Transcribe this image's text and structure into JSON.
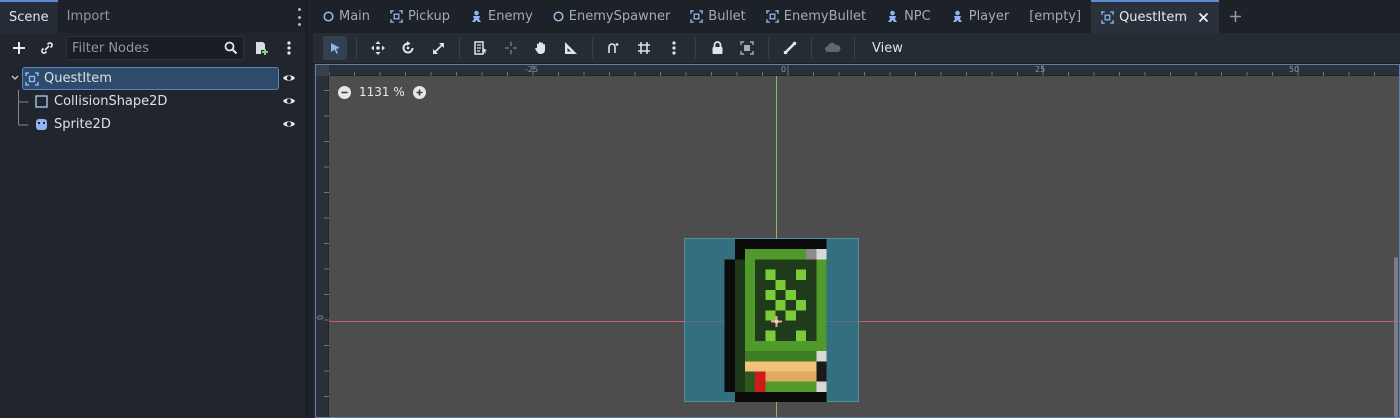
{
  "dock": {
    "tabs": [
      {
        "label": "Scene"
      },
      {
        "label": "Import"
      }
    ],
    "filter_placeholder": "Filter Nodes",
    "tree": [
      {
        "label": "QuestItem"
      },
      {
        "label": "CollisionShape2D"
      },
      {
        "label": "Sprite2D"
      }
    ]
  },
  "scene_tabs": [
    {
      "label": "Main"
    },
    {
      "label": "Pickup"
    },
    {
      "label": "Enemy"
    },
    {
      "label": "EnemySpawner"
    },
    {
      "label": "Bullet"
    },
    {
      "label": "EnemyBullet"
    },
    {
      "label": "NPC"
    },
    {
      "label": "Player"
    },
    {
      "label": "[empty]"
    },
    {
      "label": "QuestItem"
    }
  ],
  "toolbar": {
    "view_label": "View"
  },
  "viewport": {
    "zoom_label": "1131 %",
    "ruler_labels": [
      "-25",
      "0",
      "25",
      "50"
    ],
    "ruler_left_label": "0"
  },
  "colors": {
    "accent": "#5f8cd0",
    "x_axis": "#d95f6e",
    "y_axis": "#8fd05f",
    "collision": "#2a7d92"
  }
}
